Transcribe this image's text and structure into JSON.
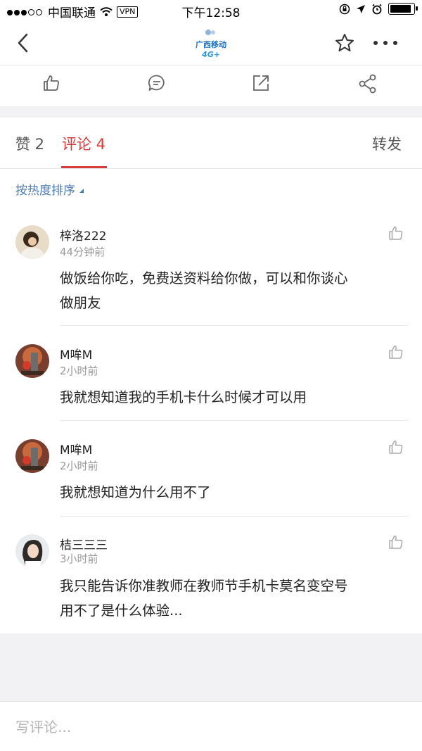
{
  "status_bar": {
    "carrier": "中国联通",
    "vpn": "VPN",
    "time": "下午12:58",
    "battery_level": 0.9
  },
  "tabs": {
    "likes": "赞 2",
    "comments": "评论 4",
    "forward": "转发"
  },
  "sort_label": "按热度排序",
  "comments": [
    {
      "name": "梓洛222",
      "time": "44分钟前",
      "text_line1": "做饭给你吃，免费送资料给你做，可以和你谈心",
      "text_line2": "做朋友"
    },
    {
      "name": "M哞M",
      "time": "2小时前",
      "text_line1": "我就想知道我的手机卡什么时候才可以用"
    },
    {
      "name": "M哞M",
      "time": "2小时前",
      "text_line1": "我就想知道为什么用不了"
    },
    {
      "name": "桔三三三",
      "time": "3小时前",
      "text_line1": "我只能告诉你准教师在教师节手机卡莫名变空号",
      "text_line2": "用不了是什么体验..."
    }
  ],
  "input_placeholder": "写评论...",
  "colors": {
    "accent": "#d63b3b",
    "link": "#4b7bb5"
  }
}
